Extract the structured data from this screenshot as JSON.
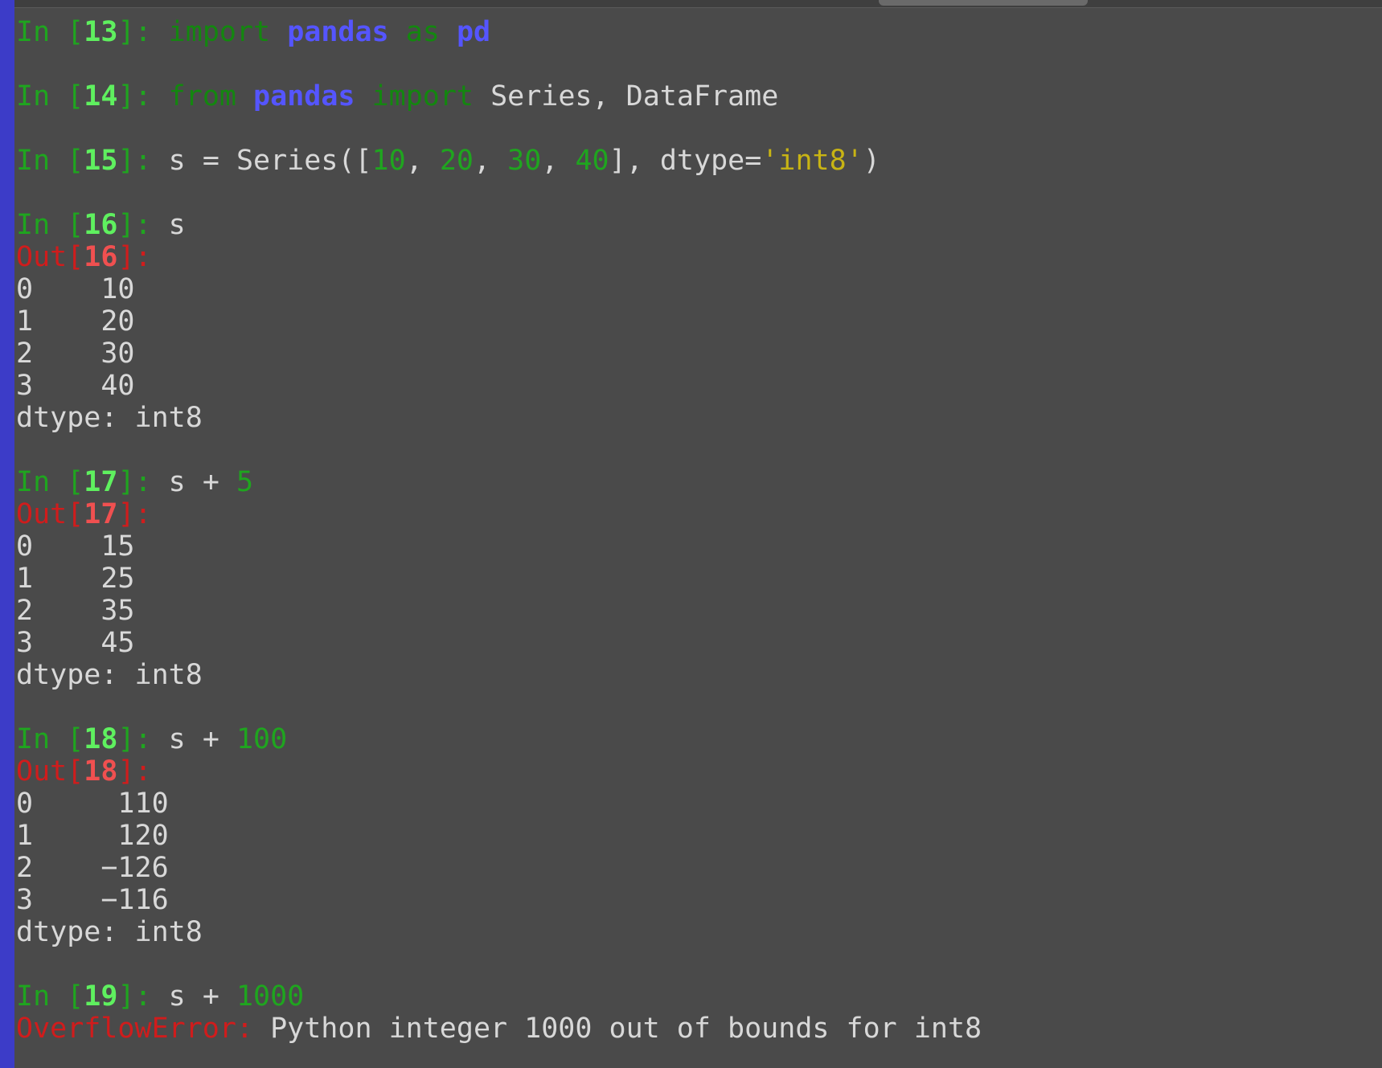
{
  "cells": [
    {
      "in_num": "13",
      "code": [
        {
          "t": "import",
          "k": "kw"
        },
        {
          "t": " ",
          "k": "txt"
        },
        {
          "t": "pandas",
          "k": "nm"
        },
        {
          "t": " ",
          "k": "txt"
        },
        {
          "t": "as",
          "k": "kw"
        },
        {
          "t": " ",
          "k": "txt"
        },
        {
          "t": "pd",
          "k": "nm"
        }
      ]
    },
    {
      "in_num": "14",
      "code": [
        {
          "t": "from",
          "k": "kw"
        },
        {
          "t": " ",
          "k": "txt"
        },
        {
          "t": "pandas",
          "k": "nm"
        },
        {
          "t": " ",
          "k": "txt"
        },
        {
          "t": "import",
          "k": "kw"
        },
        {
          "t": " Series, DataFrame",
          "k": "txt"
        }
      ]
    },
    {
      "in_num": "15",
      "code": [
        {
          "t": "s = Series([",
          "k": "txt"
        },
        {
          "t": "10",
          "k": "num"
        },
        {
          "t": ", ",
          "k": "txt"
        },
        {
          "t": "20",
          "k": "num"
        },
        {
          "t": ", ",
          "k": "txt"
        },
        {
          "t": "30",
          "k": "num"
        },
        {
          "t": ", ",
          "k": "txt"
        },
        {
          "t": "40",
          "k": "num"
        },
        {
          "t": "], dtype=",
          "k": "txt"
        },
        {
          "t": "'int8'",
          "k": "str"
        },
        {
          "t": ")",
          "k": "txt"
        }
      ]
    },
    {
      "in_num": "16",
      "code": [
        {
          "t": "s",
          "k": "txt"
        }
      ],
      "out_num": "16",
      "output": [
        "0    10",
        "1    20",
        "2    30",
        "3    40",
        "dtype: int8"
      ]
    },
    {
      "in_num": "17",
      "code": [
        {
          "t": "s + ",
          "k": "txt"
        },
        {
          "t": "5",
          "k": "num"
        }
      ],
      "out_num": "17",
      "output": [
        "0    15",
        "1    25",
        "2    35",
        "3    45",
        "dtype: int8"
      ]
    },
    {
      "in_num": "18",
      "code": [
        {
          "t": "s + ",
          "k": "txt"
        },
        {
          "t": "100",
          "k": "num"
        }
      ],
      "out_num": "18",
      "output": [
        "0     110",
        "1     120",
        "2    −126",
        "3    −116",
        "dtype: int8"
      ]
    },
    {
      "in_num": "19",
      "code": [
        {
          "t": "s + ",
          "k": "txt"
        },
        {
          "t": "1000",
          "k": "num"
        }
      ],
      "error": {
        "name": "OverflowError:",
        "message": " Python integer 1000 out of bounds for int8"
      }
    }
  ],
  "prompt": {
    "in": "In ",
    "out": "Out"
  },
  "colors": {
    "background": "#4a4a4a",
    "left_bar": "#3c3cc8",
    "prompt_in": "#1fa51f",
    "prompt_out": "#d01c1c",
    "keyword": "#13870f",
    "name": "#5555ff",
    "string": "#c8b414"
  }
}
